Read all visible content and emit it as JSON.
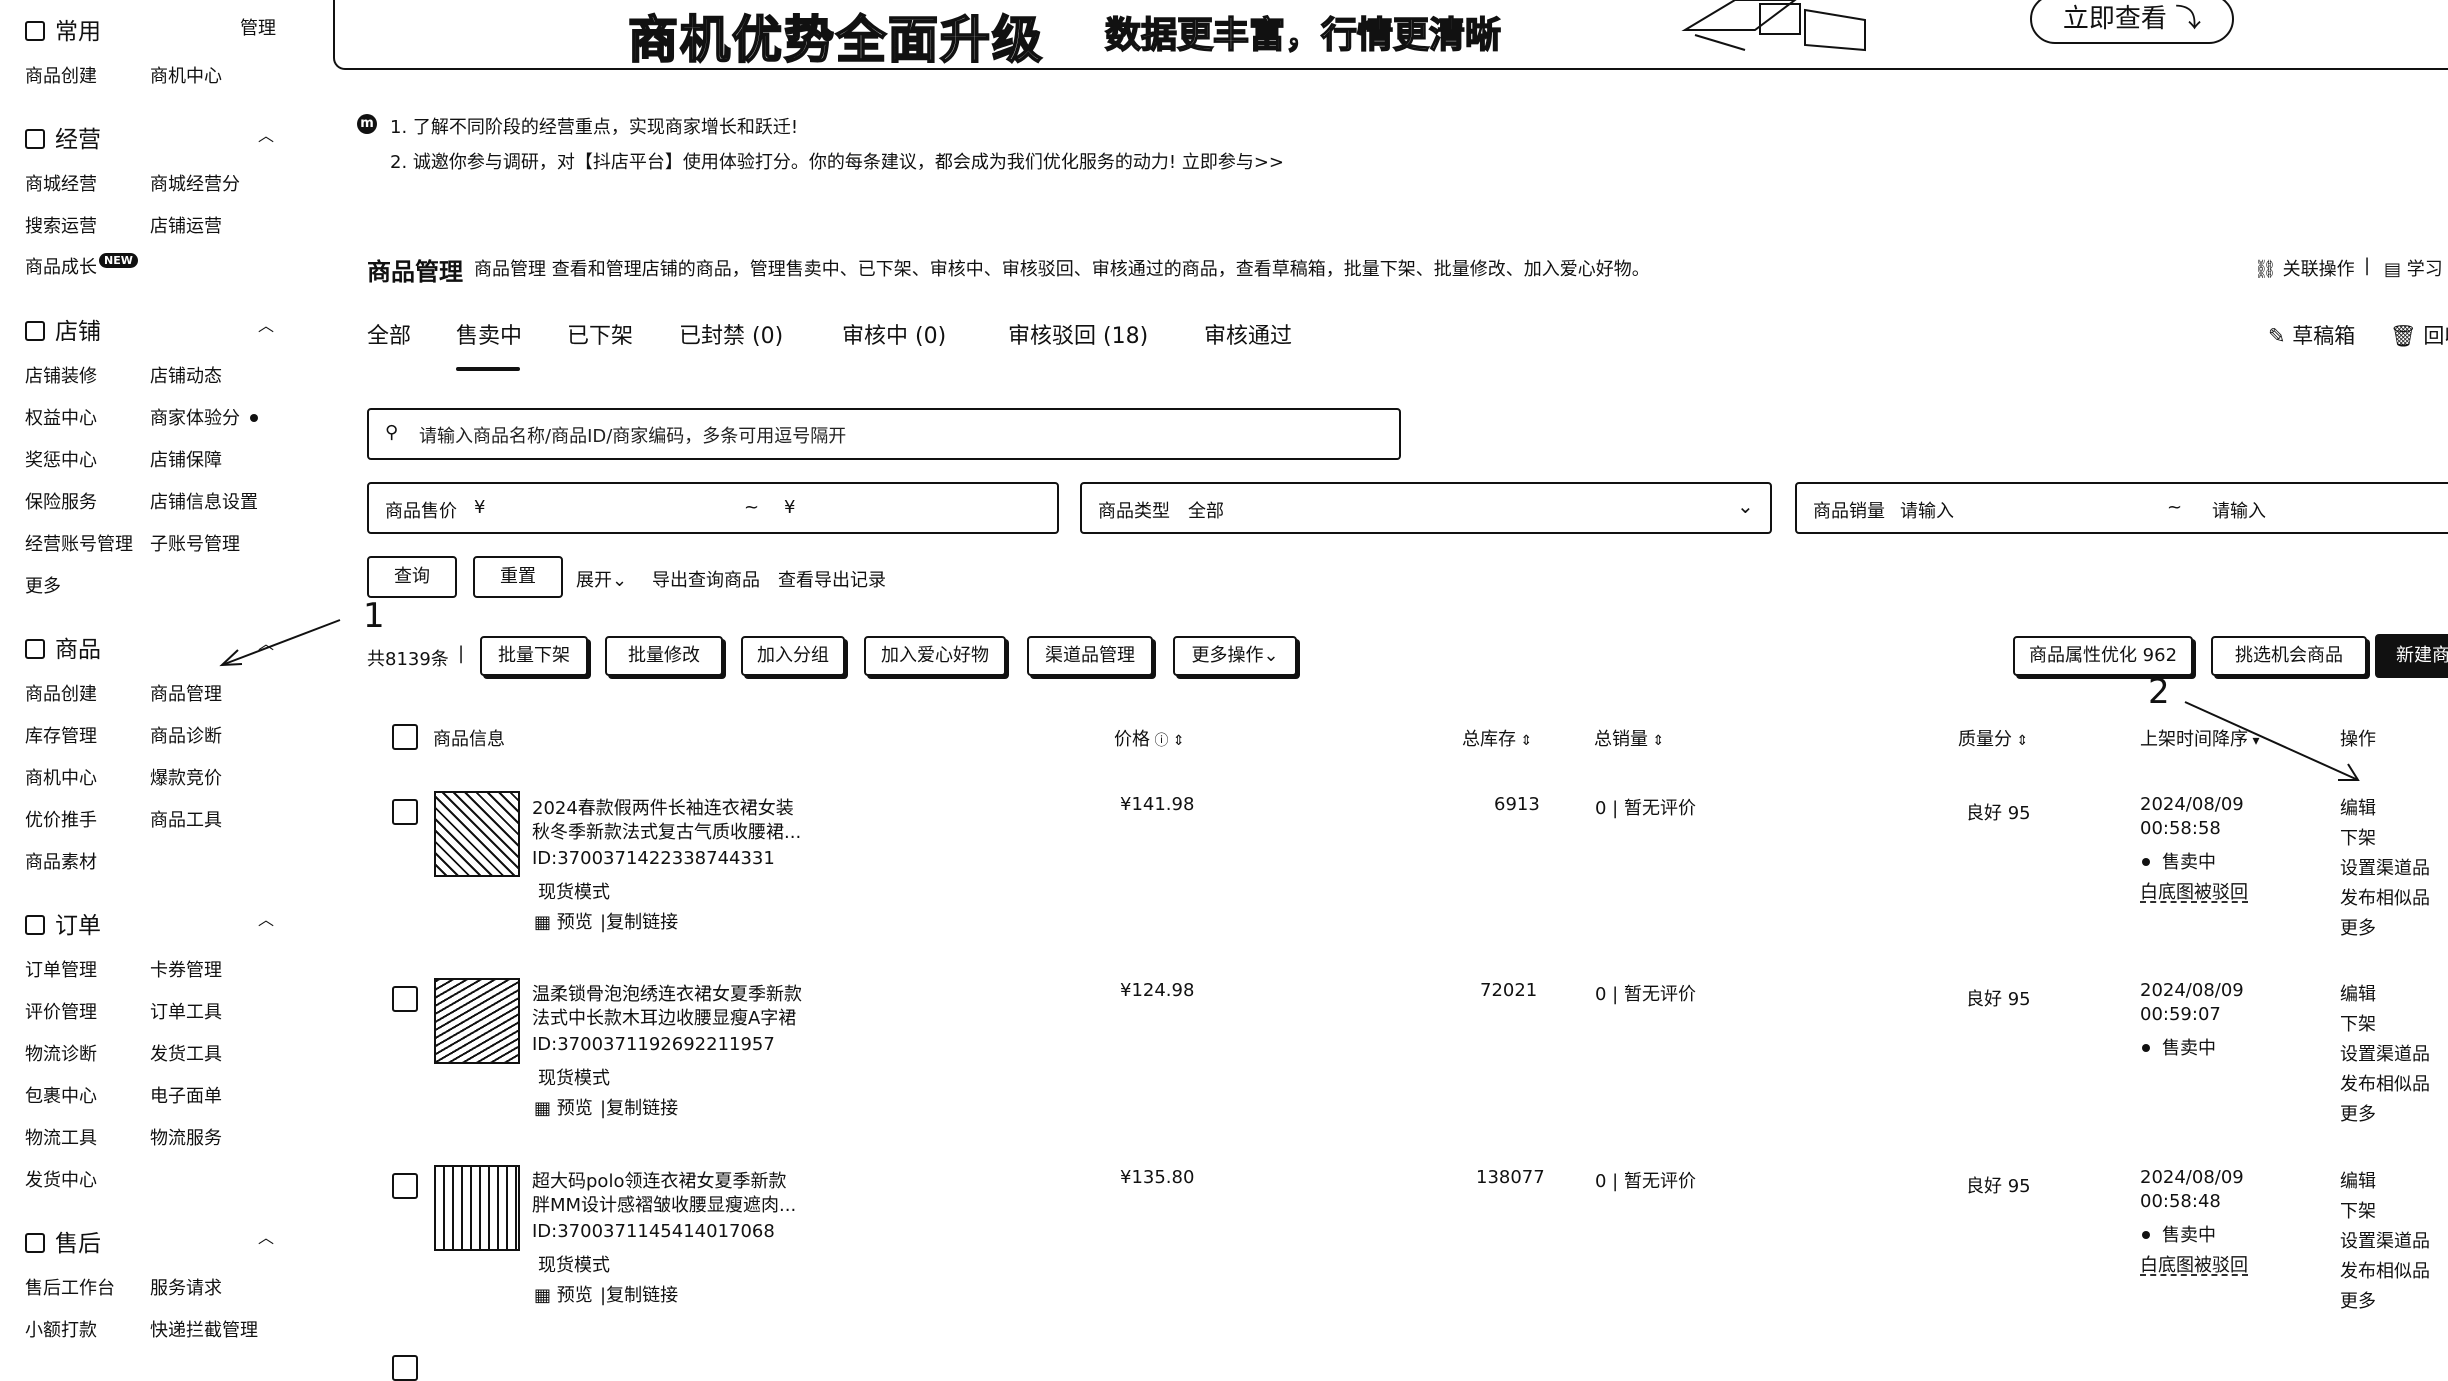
{
  "sidebar": {
    "sections": [
      {
        "title": "常用",
        "right": "管理",
        "items": [
          "商品创建",
          "商机中心"
        ]
      },
      {
        "title": "经营",
        "items": [
          "商城经营",
          "商城经营分",
          "搜索运营",
          "店铺运营",
          "商品成长"
        ],
        "badge": "NEW"
      },
      {
        "title": "店铺",
        "items": [
          "店铺装修",
          "店铺动态",
          "权益中心",
          "商家体验分",
          "奖惩中心",
          "店铺保障",
          "保险服务",
          "店铺信息设置",
          "经营账号管理",
          "子账号管理",
          "更多"
        ]
      },
      {
        "title": "商品",
        "items": [
          "商品创建",
          "商品管理",
          "库存管理",
          "商品诊断",
          "商机中心",
          "爆款竞价",
          "优价推手",
          "商品工具",
          "商品素材"
        ]
      },
      {
        "title": "订单",
        "items": [
          "订单管理",
          "卡券管理",
          "评价管理",
          "订单工具",
          "物流诊断",
          "发货工具",
          "包裹中心",
          "电子面单",
          "物流工具",
          "物流服务",
          "发货中心"
        ]
      },
      {
        "title": "售后",
        "items": [
          "售后工作台",
          "服务请求",
          "小额打款",
          "快递拦截管理"
        ]
      }
    ]
  },
  "banner": {
    "title": "商机优势全面升级",
    "subtitle": "数据更丰富，行情更清晰",
    "button": "立即查看"
  },
  "notices": [
    "1. 了解不同阶段的经营重点，实现商家增长和跃迁!",
    "2. 诚邀你参与调研，对【抖店平台】使用体验打分。你的每条建议，都会成为我们优化服务的动力! 立即参与>>"
  ],
  "header": {
    "title": "商品管理",
    "description": "商品管理 查看和管理店铺的商品，管理售卖中、已下架、审核中、审核驳回、审核通过的商品，查看草稿箱，批量下架、批量修改、加入爱心好物。",
    "link1": "关联操作",
    "link2": "学习",
    "draft": "草稿箱",
    "recycle": "回收"
  },
  "tabs": [
    "全部",
    "售卖中",
    "已下架",
    "已封禁 (0)",
    "审核中 (0)",
    "审核驳回 (18)",
    "审核通过"
  ],
  "search": {
    "placeholder": "请输入商品名称/商品ID/商家编码，多条可用逗号隔开"
  },
  "filters": {
    "price_label": "商品售价",
    "currency": "¥",
    "range_sep": "~",
    "type_label": "商品类型",
    "type_value": "全部",
    "sales_label": "商品销量",
    "sales_placeholder": "请输入"
  },
  "actions": {
    "query": "查询",
    "reset": "重置",
    "expand": "展开",
    "export": "导出查询商品",
    "export_log": "查看导出记录"
  },
  "bulk": {
    "count": "共8139条",
    "buttons": [
      "批量下架",
      "批量修改",
      "加入分组",
      "加入爱心好物",
      "渠道品管理",
      "更多操作"
    ],
    "attr_opt": "商品属性优化 962",
    "pick": "挑选机会商品",
    "create": "新建商"
  },
  "table": {
    "headers": {
      "info": "商品信息",
      "price": "价格",
      "stock": "总库存",
      "sales": "总销量",
      "quality": "质量分",
      "time": "上架时间降序",
      "ops": "操作"
    },
    "rows": [
      {
        "title1": "2024春款假两件长袖连衣裙女装",
        "title2": "秋冬季新款法式复古气质收腰裙...",
        "id": "ID:3700371422338744331",
        "mode": "现货模式",
        "preview": "预览",
        "copy": "复制链接",
        "price": "¥141.98",
        "stock": "6913",
        "sales": "0 | 暂无评价",
        "quality": "良好 95",
        "date": "2024/08/09",
        "time": "00:58:58",
        "status": "售卖中",
        "reject": "白底图被驳回"
      },
      {
        "title1": "温柔锁骨泡泡绣连衣裙女夏季新款",
        "title2": "法式中长款木耳边收腰显瘦A字裙",
        "id": "ID:3700371192692211957",
        "mode": "现货模式",
        "preview": "预览",
        "copy": "复制链接",
        "price": "¥124.98",
        "stock": "72021",
        "sales": "0 | 暂无评价",
        "quality": "良好 95",
        "date": "2024/08/09",
        "time": "00:59:07",
        "status": "售卖中",
        "reject": ""
      },
      {
        "title1": "超大码polo领连衣裙女夏季新款",
        "title2": "胖MM设计感褶皱收腰显瘦遮肉...",
        "id": "ID:3700371145414017068",
        "mode": "现货模式",
        "preview": "预览",
        "copy": "复制链接",
        "price": "¥135.80",
        "stock": "138077",
        "sales": "0 | 暂无评价",
        "quality": "良好 95",
        "date": "2024/08/09",
        "time": "00:58:48",
        "status": "售卖中",
        "reject": "白底图被驳回"
      }
    ],
    "ops": [
      "编辑",
      "下架",
      "设置渠道品",
      "发布相似品",
      "更多"
    ]
  },
  "annotations": {
    "one": "1",
    "two": "2"
  }
}
